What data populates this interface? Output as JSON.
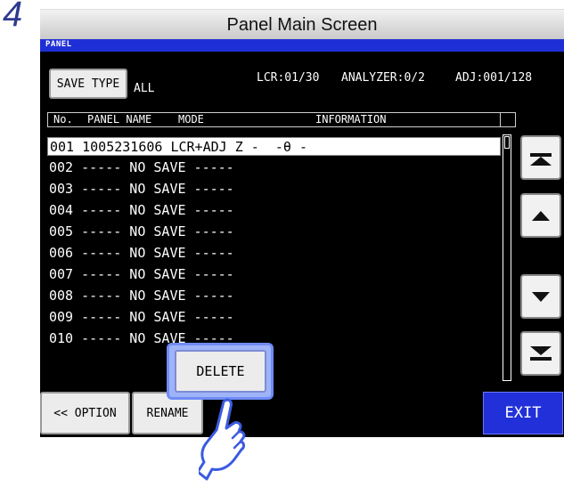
{
  "step_number": "4",
  "title": "Panel Main Screen",
  "panel_label": "PANEL",
  "save_type_button": "SAVE TYPE",
  "save_type_value": "ALL",
  "status": {
    "lcr": "LCR:01/30",
    "analyzer": "ANALYZER:0/2",
    "adj": "ADJ:001/128"
  },
  "columns": [
    "No.",
    "PANEL NAME",
    "MODE",
    "INFORMATION"
  ],
  "rows": [
    "001 1005231606 LCR+ADJ Z -  -θ -",
    "002 ----- NO SAVE -----",
    "003 ----- NO SAVE -----",
    "004 ----- NO SAVE -----",
    "005 ----- NO SAVE -----",
    "006 ----- NO SAVE -----",
    "007 ----- NO SAVE -----",
    "008 ----- NO SAVE -----",
    "009 ----- NO SAVE -----",
    "010 ----- NO SAVE -----"
  ],
  "buttons": {
    "option": "<< OPTION",
    "rename": "RENAME",
    "delete": "DELETE",
    "exit": "EXIT"
  },
  "icons": {
    "scroll_top": "double-up-arrow-icon",
    "scroll_up": "up-arrow-icon",
    "scroll_down": "down-arrow-icon",
    "scroll_bottom": "double-down-arrow-icon",
    "pointer": "pointing-hand-icon"
  },
  "colors": {
    "accent": "#1f2fd6",
    "screen_bg": "#000000",
    "highlight": "#6f8cf6"
  }
}
